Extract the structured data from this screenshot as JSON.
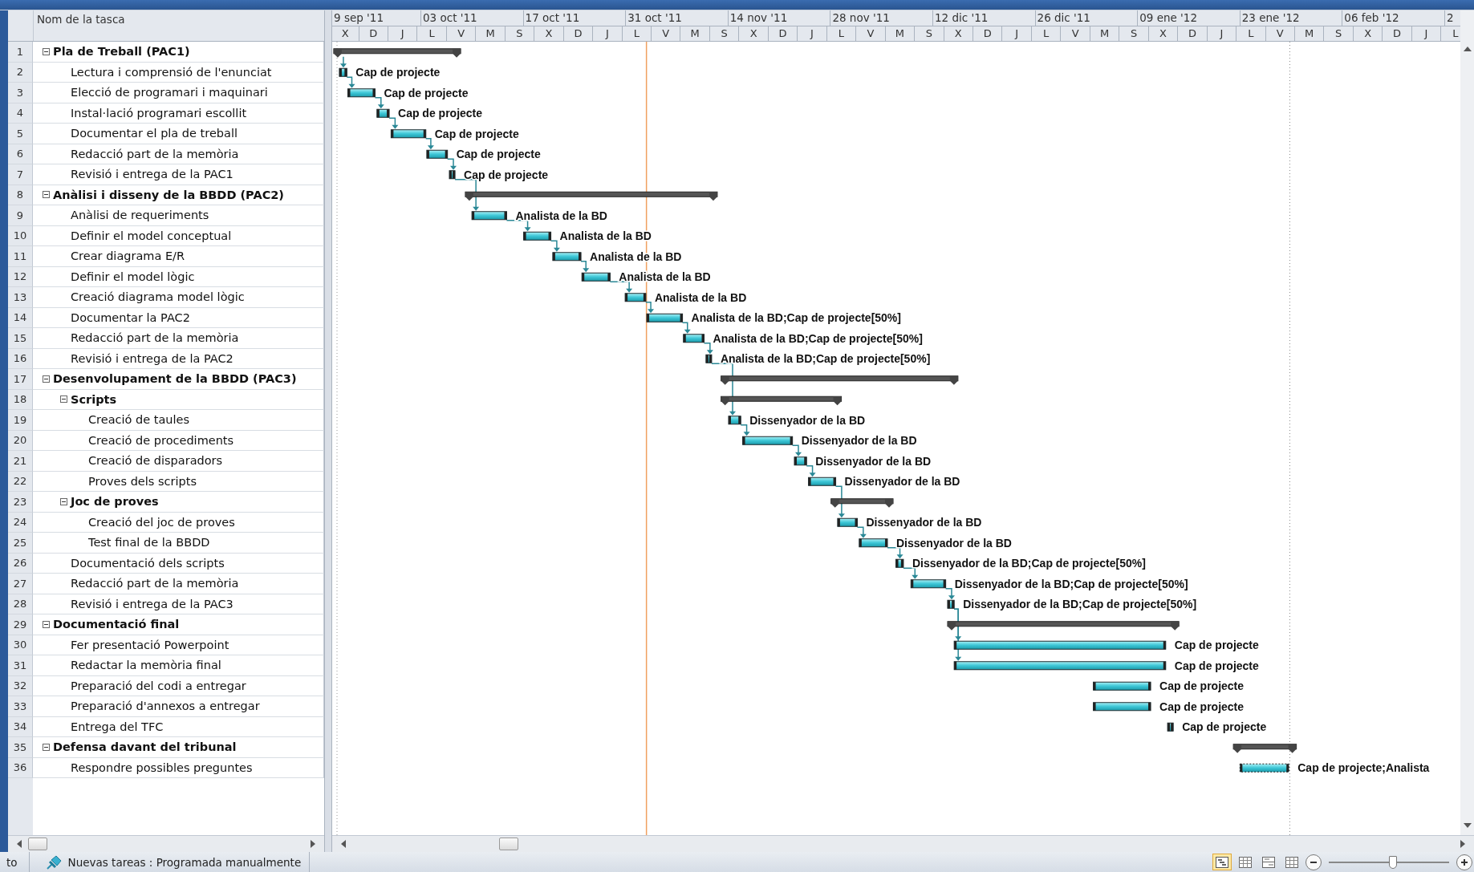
{
  "table": {
    "column_header": "Nom de la tasca",
    "tasks": [
      {
        "number": "1",
        "name": "Pla de Treball (PAC1)",
        "expanded": true,
        "children": [
          {
            "number": "2",
            "name": "Lectura i comprensió de l'enunciat",
            "resources": "Cap de projecte"
          },
          {
            "number": "3",
            "name": "Elecció de programari i maquinari",
            "resources": "Cap de projecte"
          },
          {
            "number": "4",
            "name": "Instal·lació programari escollit",
            "resources": "Cap de projecte"
          },
          {
            "number": "5",
            "name": "Documentar el pla de treball",
            "resources": "Cap de projecte"
          },
          {
            "number": "6",
            "name": "Redacció part de la memòria",
            "resources": "Cap de projecte"
          },
          {
            "number": "7",
            "name": "Revisió i entrega de la PAC1",
            "resources": "Cap de projecte"
          }
        ]
      },
      {
        "number": "8",
        "name": "Anàlisi i disseny de la BBDD (PAC2)",
        "expanded": true,
        "children": [
          {
            "number": "9",
            "name": "Anàlisi de requeriments",
            "resources": "Analista de la BD"
          },
          {
            "number": "10",
            "name": "Definir el model conceptual",
            "resources": "Analista de la BD"
          },
          {
            "number": "11",
            "name": "Crear diagrama E/R",
            "resources": "Analista de la BD"
          },
          {
            "number": "12",
            "name": "Definir el model lògic",
            "resources": "Analista de la BD"
          },
          {
            "number": "13",
            "name": "Creació diagrama model lògic",
            "resources": "Analista de la BD"
          },
          {
            "number": "14",
            "name": "Documentar la PAC2",
            "resources": "Analista de la BD;Cap de projecte[50%]"
          },
          {
            "number": "15",
            "name": "Redacció part de la memòria",
            "resources": "Analista de la BD;Cap de projecte[50%]"
          },
          {
            "number": "16",
            "name": "Revisió i entrega de la PAC2",
            "resources": "Analista de la BD;Cap de projecte[50%]"
          }
        ]
      },
      {
        "number": "17",
        "name": "Desenvolupament de la BBDD (PAC3)",
        "expanded": true,
        "children": [
          {
            "number": "18",
            "name": "Scripts",
            "expanded": true,
            "children": [
              {
                "number": "19",
                "name": "Creació de taules",
                "resources": "Dissenyador de la BD"
              },
              {
                "number": "20",
                "name": "Creació de procediments",
                "resources": "Dissenyador de la BD"
              },
              {
                "number": "21",
                "name": "Creació de disparadors",
                "resources": "Dissenyador de la BD"
              },
              {
                "number": "22",
                "name": "Proves dels scripts",
                "resources": "Dissenyador de la BD"
              }
            ]
          },
          {
            "number": "23",
            "name": "Joc de proves",
            "expanded": true,
            "children": [
              {
                "number": "24",
                "name": "Creació del joc de proves",
                "resources": "Dissenyador de la BD"
              },
              {
                "number": "25",
                "name": "Test final de la BBDD",
                "resources": "Dissenyador de la BD"
              }
            ]
          },
          {
            "number": "26",
            "name": "Documentació dels scripts",
            "resources": "Dissenyador de la BD;Cap de projecte[50%]"
          },
          {
            "number": "27",
            "name": "Redacció part de la memòria",
            "resources": "Dissenyador de la BD;Cap de projecte[50%]"
          },
          {
            "number": "28",
            "name": "Revisió i entrega de la PAC3",
            "resources": "Dissenyador de la BD;Cap de projecte[50%]"
          }
        ]
      },
      {
        "number": "29",
        "name": "Documentació final",
        "expanded": true,
        "children": [
          {
            "number": "30",
            "name": "Fer presentació Powerpoint",
            "resources": "Cap de projecte"
          },
          {
            "number": "31",
            "name": "Redactar la memòria final",
            "resources": "Cap de projecte"
          },
          {
            "number": "32",
            "name": "Preparació del codi a entregar",
            "resources": "Cap de projecte"
          },
          {
            "number": "33",
            "name": "Preparació d'annexos a entregar",
            "resources": "Cap de projecte"
          },
          {
            "number": "34",
            "name": "Entrega del TFC",
            "resources": "Cap de projecte"
          }
        ]
      },
      {
        "number": "35",
        "name": "Defensa davant del tribunal",
        "expanded": true,
        "children": [
          {
            "number": "36",
            "name": "Respondre possibles preguntes",
            "resources": "Cap de projecte;Analista"
          }
        ]
      }
    ]
  },
  "timescale": {
    "major": [
      "9 sep '11",
      "03 oct '11",
      "17 oct '11",
      "31 oct '11",
      "14 nov '11",
      "28 nov '11",
      "12 dic '11",
      "26 dic '11",
      "09 ene '12",
      "23 ene '12",
      "06 feb '12",
      "2"
    ],
    "minor": [
      "X",
      "D",
      "J",
      "L",
      "V",
      "M",
      "S",
      "X",
      "D",
      "J",
      "L",
      "V",
      "M",
      "S",
      "X",
      "D",
      "J",
      "L",
      "V",
      "M",
      "S",
      "X",
      "D",
      "J",
      "L",
      "V",
      "M",
      "S",
      "X",
      "D",
      "J",
      "L",
      "V",
      "M",
      "S",
      "X",
      "D",
      "J",
      "L"
    ]
  },
  "status_bar": {
    "mode": "to",
    "new_tasks": "Nuevas tareas : Programada manualmente",
    "views": [
      {
        "selected": true
      },
      {
        "selected": false
      },
      {
        "selected": false
      },
      {
        "selected": false
      }
    ],
    "zoom": {
      "level": 0.53
    }
  }
}
